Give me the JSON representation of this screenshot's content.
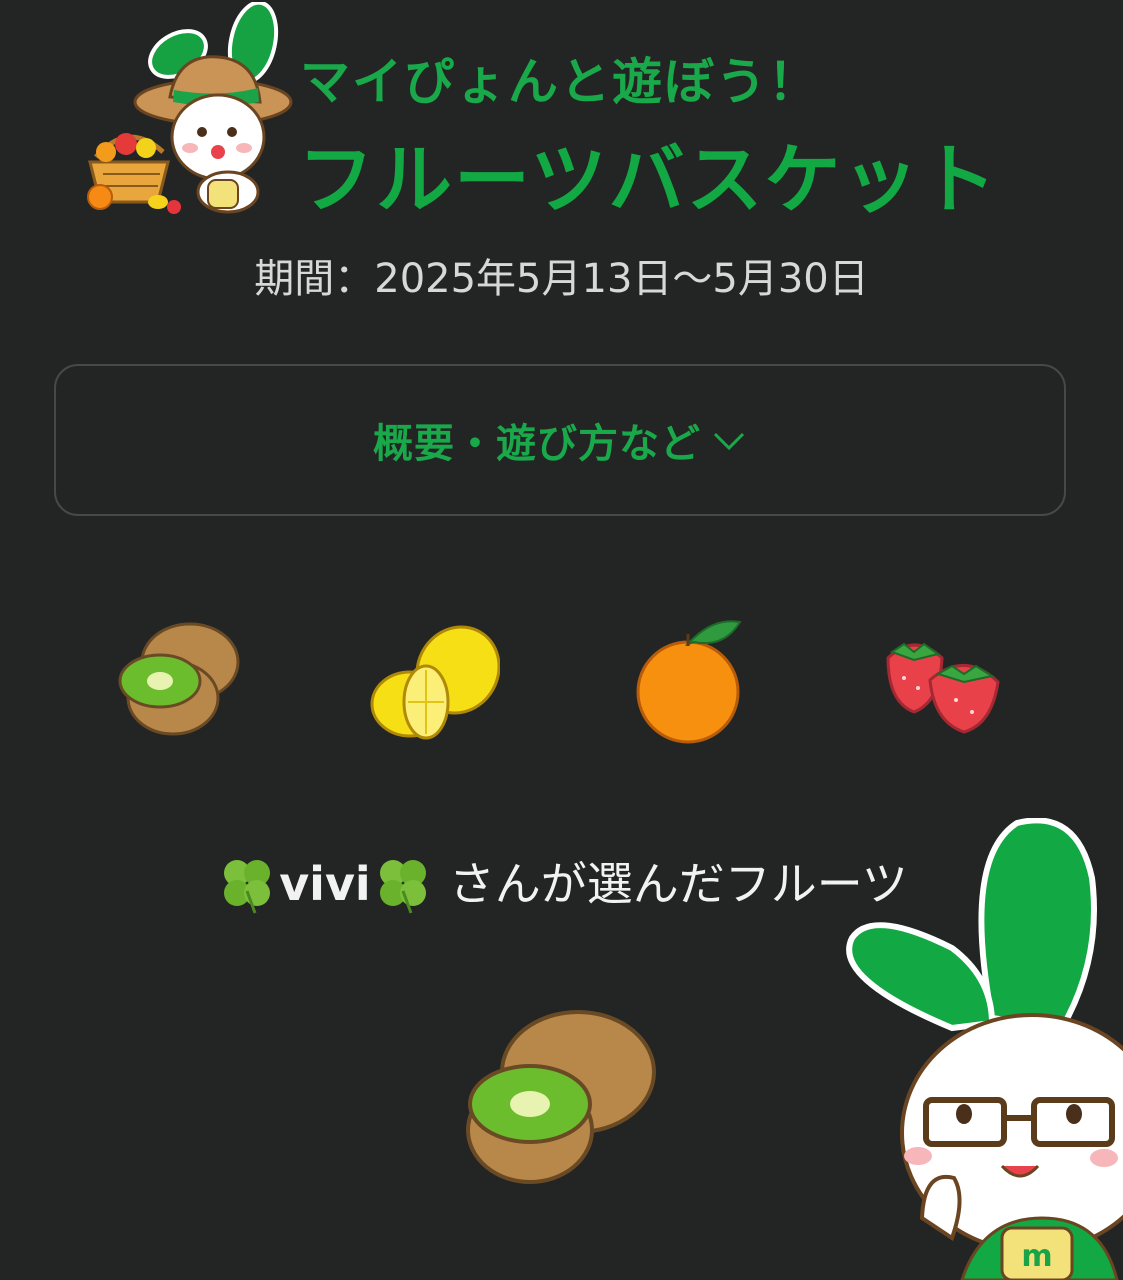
{
  "header": {
    "subtitle": "マイぴょんと遊ぼう！",
    "title": "フルーツバスケット",
    "period": "期間：2025年5月13日〜5月30日"
  },
  "info_toggle": {
    "label": "概要・遊び方など",
    "icon": "chevron-down-icon"
  },
  "fruit_choices": [
    {
      "name": "kiwi",
      "icon": "kiwi-icon"
    },
    {
      "name": "lemon",
      "icon": "lemon-icon"
    },
    {
      "name": "orange",
      "icon": "orange-icon"
    },
    {
      "name": "strawberry",
      "icon": "strawberry-icon"
    }
  ],
  "result": {
    "user_name": "vivi",
    "suffix": "さんが選んだフルーツ",
    "clover_icon": "four-leaf-clover-icon",
    "selected_fruit": "kiwi"
  },
  "colors": {
    "background": "#232524",
    "accent_green": "#12a843",
    "text_light": "#d8d8d8",
    "box_border": "#45494a"
  }
}
